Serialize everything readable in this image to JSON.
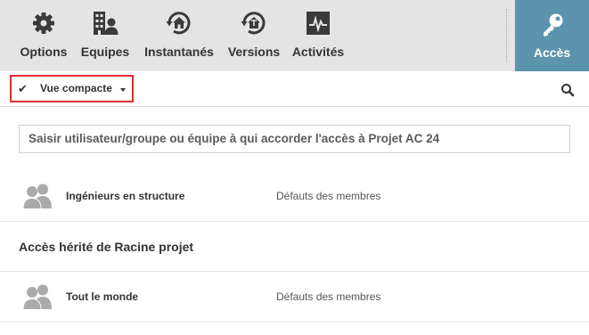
{
  "toolbar": {
    "options_label": "Options",
    "equipes_label": "Equipes",
    "instantanes_label": "Instantanés",
    "versions_label": "Versions",
    "activites_label": "Activités",
    "acces_label": "Accès"
  },
  "icons": {
    "options": "gear-icon",
    "equipes": "team-building-icon",
    "instantanes": "snapshot-house-icon",
    "versions": "versions-house-icon",
    "activites": "activity-chart-icon",
    "acces": "key-icon",
    "search": "search-icon",
    "checkmark": "check-icon",
    "avatar": "group-avatar-icon"
  },
  "colors": {
    "toolbar_bg": "#e4e4e4",
    "acces_bg": "#5c93ad",
    "highlight_border": "#e03030",
    "avatar_gray": "#aaaaaa"
  },
  "view": {
    "check": "✔",
    "compact_label": "Vue compacte"
  },
  "access_input": {
    "prompt": "Saisir utilisateur/groupe ou équipe à qui accorder l'accès à  Projet AC 24"
  },
  "members": [
    {
      "name": "Ingénieurs en structure",
      "role": "Défauts des membres"
    }
  ],
  "inherited": {
    "heading": "Accès hérité de Racine projet",
    "members": [
      {
        "name": "Tout le monde",
        "role": "Défauts des membres"
      }
    ]
  }
}
